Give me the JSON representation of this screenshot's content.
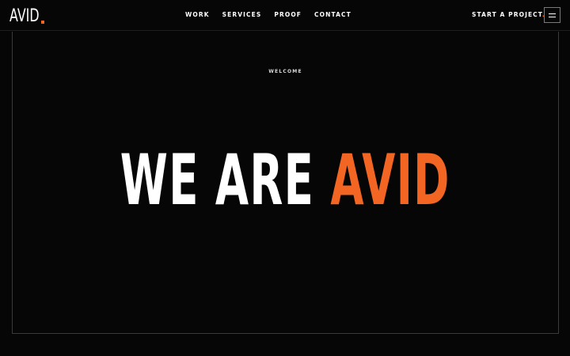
{
  "header": {
    "logo": {
      "text": "AVID",
      "dot_color": "#f26522"
    },
    "nav": [
      {
        "label": "WORK"
      },
      {
        "label": "SERVICES"
      },
      {
        "label": "PROOF"
      },
      {
        "label": "CONTACT"
      }
    ],
    "cta": {
      "label": "START A PROJECT",
      "dot": "."
    },
    "menu_icon": "hamburger-icon"
  },
  "hero": {
    "eyebrow": "WELCOME",
    "headline_prefix": "WE ARE",
    "headline_accent": "AVID",
    "accent_color": "#f26522"
  }
}
